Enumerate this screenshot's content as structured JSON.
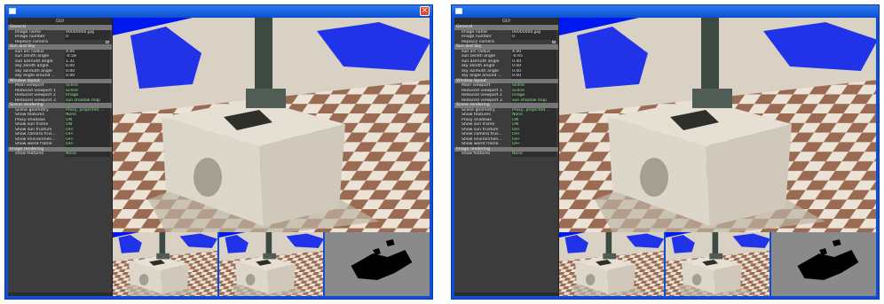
{
  "windows": [
    {
      "gui": {
        "title": "GUI",
        "sections": [
          {
            "label": "General",
            "rows": [
              {
                "label": "Image name",
                "value": "00000000.jpg",
                "green": false
              },
              {
                "label": "Image number",
                "value": "0",
                "green": false
              },
              {
                "label": "Replace camera",
                "value": "",
                "green": false,
                "checkbox": true
              }
            ]
          },
          {
            "label": "Sun and Sky",
            "rows": [
              {
                "label": "sun arc radius",
                "value": "4.00",
                "green": false
              },
              {
                "label": "sun zenith angle",
                "value": "-0.58",
                "green": false
              },
              {
                "label": "sun azimuth angle",
                "value": "1.31",
                "green": false
              },
              {
                "label": "sky zenith angle",
                "value": "0.00",
                "green": false
              },
              {
                "label": "sky azimuth angle",
                "value": "0.00",
                "green": false
              },
              {
                "label": "sky angle around ...",
                "value": "0.00",
                "green": false
              }
            ]
          },
          {
            "label": "Window layout",
            "rows": [
              {
                "label": "Main viewport",
                "value": "Scene",
                "green": true
              },
              {
                "label": "Reduced viewport 1",
                "value": "Scene",
                "green": true
              },
              {
                "label": "Reduced viewport 2",
                "value": "Image",
                "green": true
              },
              {
                "label": "Reduced viewport 3",
                "value": "sun shadow map",
                "green": true
              }
            ]
          },
          {
            "label": "Scene rendering",
            "rows": [
              {
                "label": "Scene geometry",
                "value": "Proxy, projected ...",
                "green": true
              },
              {
                "label": "Show features",
                "value": "None",
                "green": true
              },
              {
                "label": "Proxy shadows",
                "value": "ON",
                "green": true
              },
              {
                "label": "Show sun frame",
                "value": "ON",
                "green": true
              },
              {
                "label": "Show sun frustum",
                "value": "OFF",
                "green": true
              },
              {
                "label": "Show camera frus...",
                "value": "OFF",
                "green": true
              },
              {
                "label": "Show environmen...",
                "value": "OFF",
                "green": true
              },
              {
                "label": "Show world frame",
                "value": "OFF",
                "green": true
              }
            ]
          },
          {
            "label": "Image rendering",
            "rows": [
              {
                "label": "show features",
                "value": "None",
                "green": true
              }
            ]
          }
        ]
      }
    },
    {
      "gui": {
        "title": "GUI",
        "sections": [
          {
            "label": "General",
            "rows": [
              {
                "label": "Image name",
                "value": "00000000.jpg",
                "green": false
              },
              {
                "label": "Image number",
                "value": "0",
                "green": false
              },
              {
                "label": "Replace camera",
                "value": "",
                "green": false,
                "checkbox": true
              }
            ]
          },
          {
            "label": "Sun and Sky",
            "rows": [
              {
                "label": "sun arc radius",
                "value": "4.00",
                "green": false
              },
              {
                "label": "sun zenith angle",
                "value": "-0.95",
                "green": false
              },
              {
                "label": "sun azimuth angle",
                "value": "0.40",
                "green": false
              },
              {
                "label": "sky zenith angle",
                "value": "0.00",
                "green": false
              },
              {
                "label": "sky azimuth angle",
                "value": "0.00",
                "green": false
              },
              {
                "label": "sky angle around ...",
                "value": "0.00",
                "green": false
              }
            ]
          },
          {
            "label": "Window layout",
            "rows": [
              {
                "label": "Main viewport",
                "value": "Scene",
                "green": true
              },
              {
                "label": "Reduced viewport 1",
                "value": "Scene",
                "green": true
              },
              {
                "label": "Reduced viewport 2",
                "value": "Image",
                "green": true
              },
              {
                "label": "Reduced viewport 3",
                "value": "sun shadow map",
                "green": true
              }
            ]
          },
          {
            "label": "Scene rendering",
            "rows": [
              {
                "label": "Scene geometry",
                "value": "Proxy, projected ...",
                "green": true
              },
              {
                "label": "Show features",
                "value": "None",
                "green": true
              },
              {
                "label": "Proxy shadows",
                "value": "ON",
                "green": true
              },
              {
                "label": "Show sun frame",
                "value": "ON",
                "green": true
              },
              {
                "label": "Show sun frustum",
                "value": "OFF",
                "green": true
              },
              {
                "label": "Show camera frus...",
                "value": "OFF",
                "green": true
              },
              {
                "label": "Show environmen...",
                "value": "OFF",
                "green": true
              },
              {
                "label": "Show world frame",
                "value": "OFF",
                "green": true
              }
            ]
          },
          {
            "label": "Image rendering",
            "rows": [
              {
                "label": "show features",
                "value": "None",
                "green": true
              }
            ]
          }
        ]
      }
    }
  ],
  "colors": {
    "titlebar": "#0a4fd0",
    "close": "#e0472b",
    "gui_bg": "#3c3c3c",
    "section_bg": "#777777",
    "sky": "#0018f0",
    "value_green": "#8ee38e"
  },
  "icons": {
    "close": "close-icon",
    "app": "app-icon"
  }
}
